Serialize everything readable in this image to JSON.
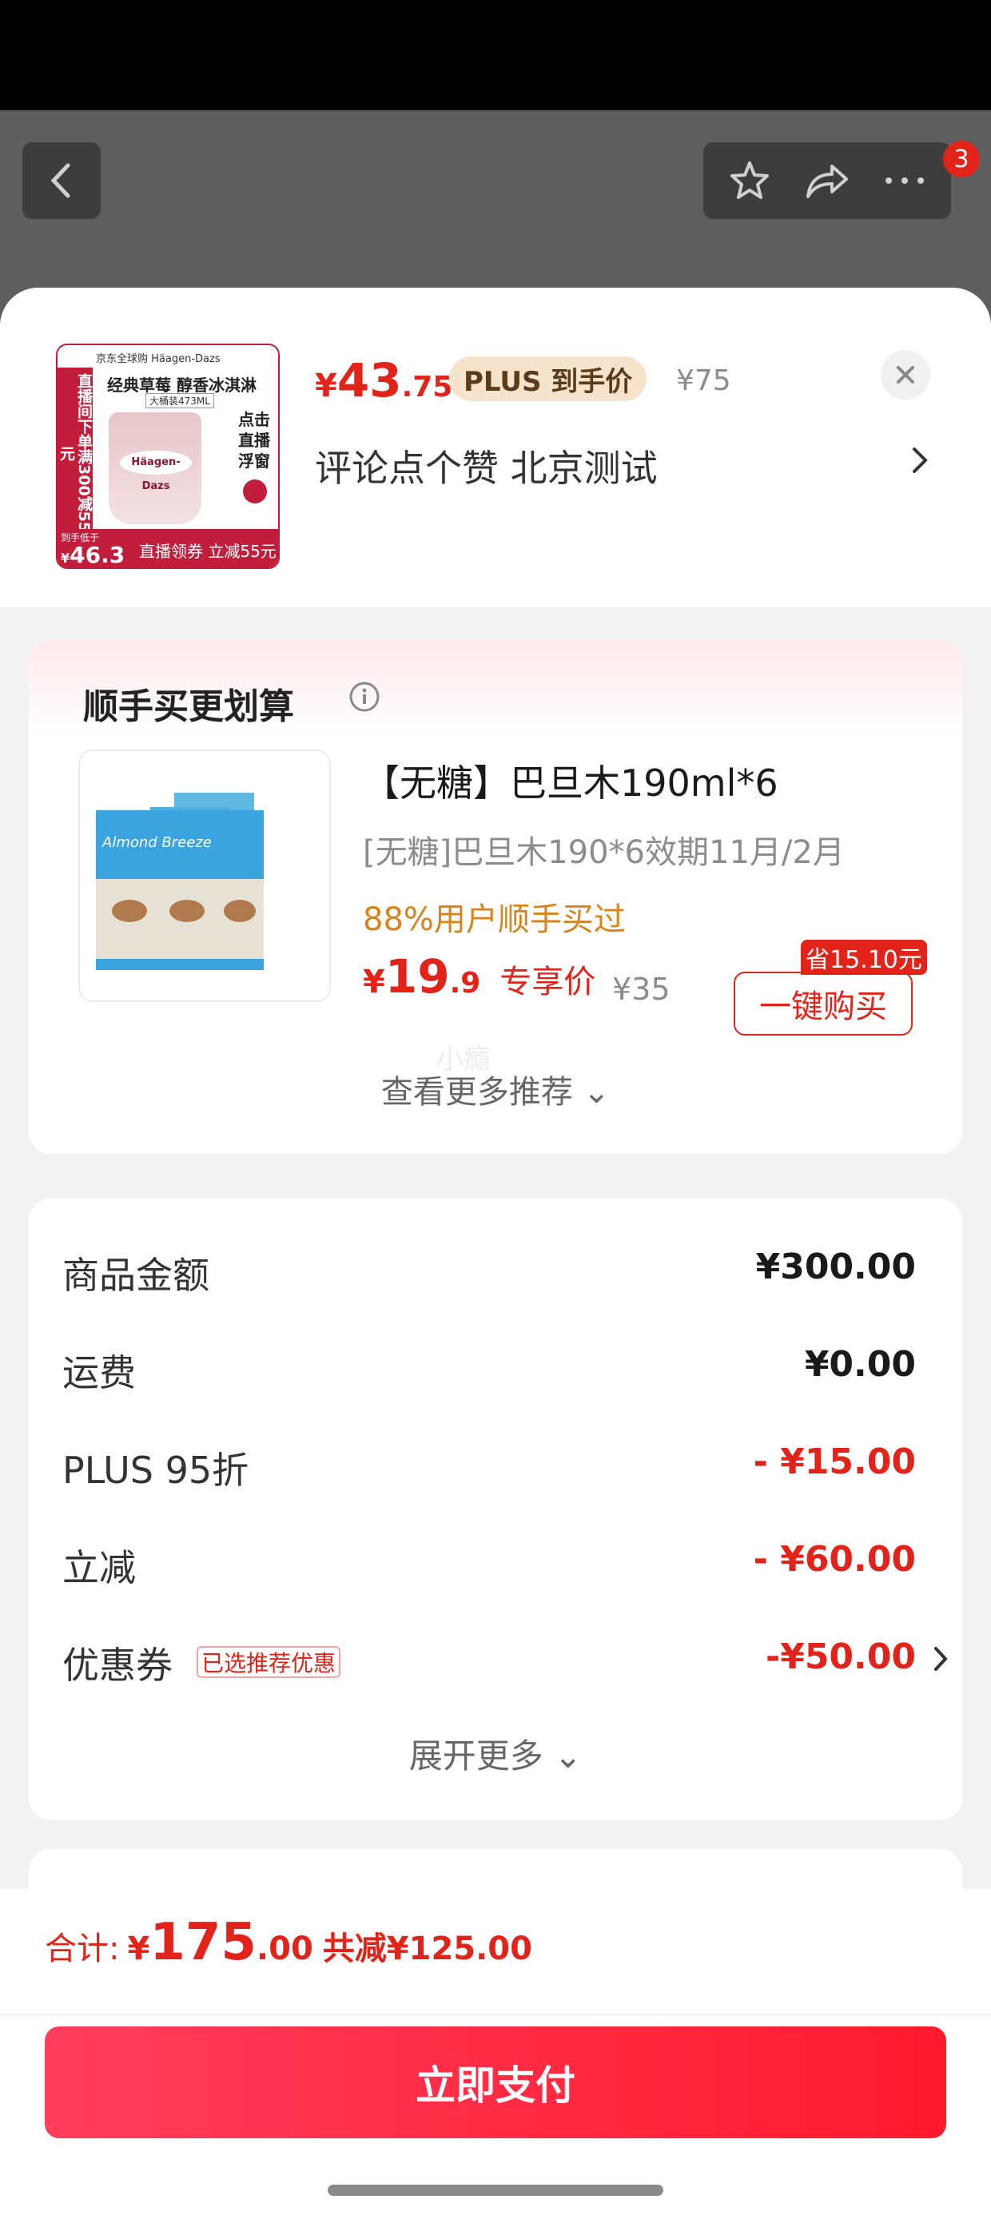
{
  "nav": {
    "cart_badge": "3",
    "icons": [
      "back-icon",
      "star-icon",
      "share-icon",
      "more-icon"
    ]
  },
  "product": {
    "thumb": {
      "brand": "京东全球购  Häagen-Dazs",
      "title": "经典草莓  醇香冰淇淋",
      "size": "大桶装473ML",
      "left_band": "直播间下单满300减55元",
      "cup_label": "Häagen-Dazs",
      "side_text": "点击直播浮窗",
      "price_tag": "到手低于",
      "price_sym": "¥",
      "price_big": "46.3",
      "promo": "直播领券 立减55元"
    },
    "price_sym": "¥",
    "price_int": "43",
    "price_dec": ".75",
    "plus_tag": "PLUS 到手价",
    "orig_price": "¥75",
    "spec": "评论点个赞  北京测试"
  },
  "recommend": {
    "title": "顺手买更划算",
    "name": "【无糖】巴旦木190ml*6",
    "desc": "[无糖]巴旦木190*6效期11月/2月",
    "stat": "88%用户顺手买过",
    "price_sym": "¥",
    "price_int": "19",
    "price_dec": ".9",
    "exclusive": "专享价",
    "orig_price": "¥35",
    "save_tag": "省15.10元",
    "buy_label": "一键购买",
    "watermark": "小瘾",
    "more": "查看更多推荐 ⌄",
    "img_brand": "Almond Breeze"
  },
  "fees": {
    "rows": [
      {
        "label": "商品金额",
        "value": "¥300.00",
        "red": false
      },
      {
        "label": "运费",
        "value": "¥0.00",
        "red": false
      },
      {
        "label": "PLUS 95折",
        "value": "- ¥15.00",
        "red": true
      },
      {
        "label": "立减",
        "value": "- ¥60.00",
        "red": true
      },
      {
        "label": "优惠券",
        "value": "-¥50.00",
        "red": true
      }
    ],
    "coupon_tag": "已选推荐优惠",
    "expand": "展开更多 ⌄"
  },
  "footer": {
    "total_label": "合计:",
    "total_sym": "¥",
    "total_int": "175",
    "total_dec": ".00",
    "total_save": "共减¥125.00",
    "pay_label": "立即支付"
  },
  "colors": {
    "accent": "#e2231a",
    "plus_bg": "#f5e3cc",
    "stat": "#d9841a"
  }
}
